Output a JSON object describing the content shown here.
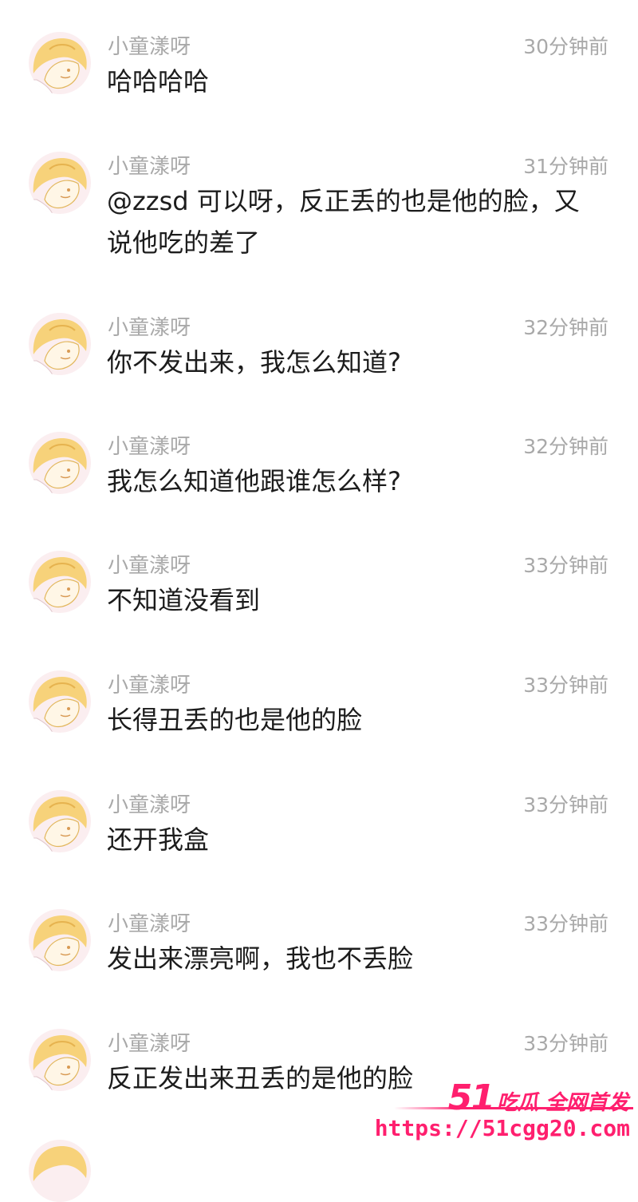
{
  "comments": [
    {
      "username": "小童漾呀",
      "time": "30分钟前",
      "text": "哈哈哈哈"
    },
    {
      "username": "小童漾呀",
      "time": "31分钟前",
      "text": "@zzsd 可以呀，反正丢的也是他的脸，又说他吃的差了"
    },
    {
      "username": "小童漾呀",
      "time": "32分钟前",
      "text": "你不发出来，我怎么知道?"
    },
    {
      "username": "小童漾呀",
      "time": "32分钟前",
      "text": "我怎么知道他跟谁怎么样?"
    },
    {
      "username": "小童漾呀",
      "time": "33分钟前",
      "text": "不知道没看到"
    },
    {
      "username": "小童漾呀",
      "time": "33分钟前",
      "text": "长得丑丢的也是他的脸"
    },
    {
      "username": "小童漾呀",
      "time": "33分钟前",
      "text": "还开我盒"
    },
    {
      "username": "小童漾呀",
      "time": "33分钟前",
      "text": "发出来漂亮啊，我也不丢脸"
    },
    {
      "username": "小童漾呀",
      "time": "33分钟前",
      "text": "反正发出来丑丢的是他的脸"
    }
  ],
  "watermark": {
    "number": "51",
    "slogan": "吃瓜 全网首发",
    "url": "https://51cgg20.com"
  },
  "colors": {
    "meta_text": "#a9a9a9",
    "body_text": "#1c1c1c",
    "watermark": "#ff1f6e",
    "avatar_hair": "#f7d27a",
    "avatar_bg": "#fbeef0"
  },
  "avatar_icon": "anime-girl-avatar"
}
